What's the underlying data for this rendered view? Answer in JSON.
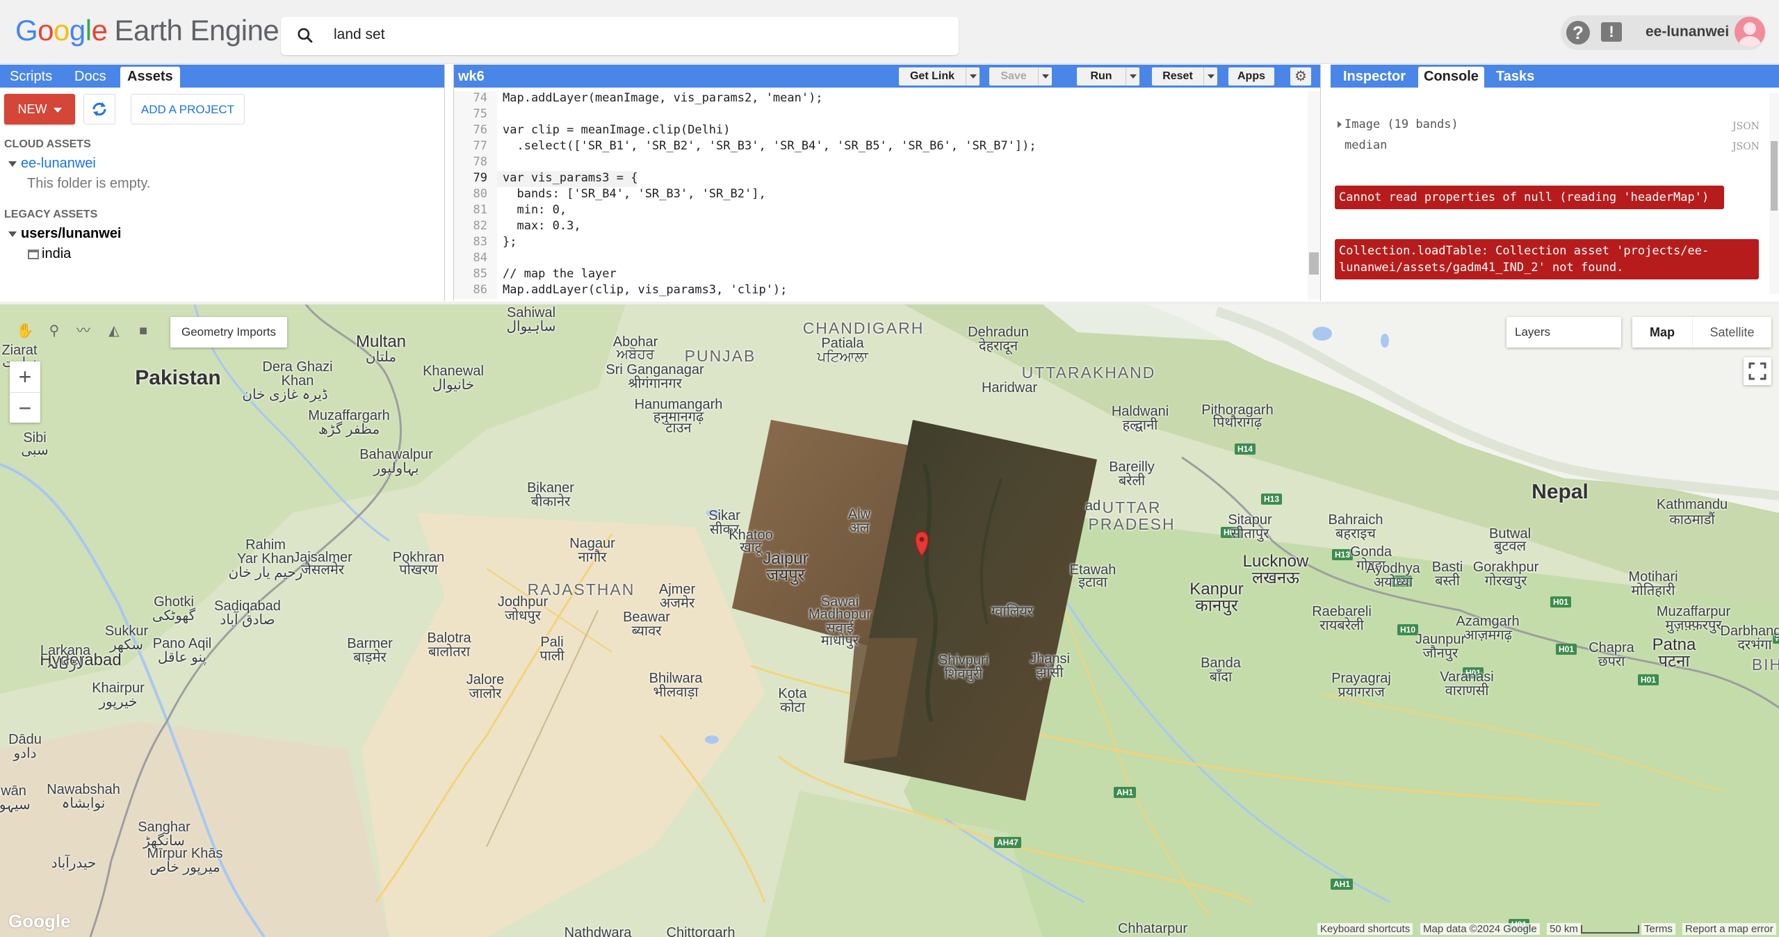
{
  "header": {
    "logo_google": [
      "G",
      "o",
      "o",
      "g",
      "l",
      "e"
    ],
    "logo_product": "Earth Engine",
    "search_value": "land set",
    "account_name": "ee-lunanwei",
    "help_glyph": "?",
    "feedback_glyph": "!"
  },
  "left_panel": {
    "tabs": [
      "Scripts",
      "Docs",
      "Assets"
    ],
    "active_tab": "Assets",
    "new_button": "NEW",
    "add_project_button": "ADD A PROJECT",
    "cloud_assets_label": "CLOUD ASSETS",
    "cloud_folder": "ee-lunanwei",
    "cloud_empty": "This folder is empty.",
    "legacy_assets_label": "LEGACY ASSETS",
    "legacy_folder": "users/lunanwei",
    "legacy_item": "india"
  },
  "code_panel": {
    "title": "wk6",
    "buttons": {
      "get_link": "Get Link",
      "save": "Save",
      "run": "Run",
      "reset": "Reset",
      "apps": "Apps"
    },
    "lines": [
      {
        "n": "74",
        "code": "Map.addLayer(meanImage, vis_params2, 'mean');"
      },
      {
        "n": "75",
        "code": ""
      },
      {
        "n": "76",
        "code": "var clip = meanImage.clip(Delhi)"
      },
      {
        "n": "77",
        "code": "  .select(['SR_B1', 'SR_B2', 'SR_B3', 'SR_B4', 'SR_B5', 'SR_B6', 'SR_B7']);"
      },
      {
        "n": "78",
        "code": ""
      },
      {
        "n": "79",
        "code": "var vis_params3 = {"
      },
      {
        "n": "80",
        "code": "  bands: ['SR_B4', 'SR_B3', 'SR_B2'],"
      },
      {
        "n": "81",
        "code": "  min: 0,"
      },
      {
        "n": "82",
        "code": "  max: 0.3,"
      },
      {
        "n": "83",
        "code": "};"
      },
      {
        "n": "84",
        "code": ""
      },
      {
        "n": "85",
        "code": "// map the layer"
      },
      {
        "n": "86",
        "code": "Map.addLayer(clip, vis_params3, 'clip');"
      }
    ]
  },
  "right_panel": {
    "tabs": [
      "Inspector",
      "Console",
      "Tasks"
    ],
    "active_tab": "Console",
    "console": {
      "image_label": "Image (19 bands)",
      "median_label": "median",
      "json_label": "JSON",
      "error1": "Cannot read properties of null (reading 'headerMap')",
      "error2_line1": "Collection.loadTable: Collection asset 'projects/ee-",
      "error2_line2": "lunanwei/assets/gadm41_IND_2' not found."
    }
  },
  "map": {
    "geometry_imports": "Geometry Imports",
    "layers": "Layers",
    "map_type": "Map",
    "satellite_type": "Satellite",
    "zoom_in": "+",
    "zoom_out": "−",
    "places": [
      {
        "id": "pakistan",
        "name": "Pakistan"
      },
      {
        "id": "nepal",
        "name": "Nepal"
      },
      {
        "id": "punjab",
        "name": "PUNJAB"
      },
      {
        "id": "uttarakhand",
        "name": "UTTARAKHAND"
      },
      {
        "id": "rajasthan",
        "name": "RAJASTHAN"
      },
      {
        "id": "uttar",
        "name": "UTTAR"
      },
      {
        "id": "pradesh",
        "name": "PRADESH"
      },
      {
        "id": "chandigarh",
        "name": "CHANDIGARH"
      },
      {
        "id": "multan",
        "name": "Multan"
      },
      {
        "id": "jaipur",
        "name": "Jaipur"
      },
      {
        "id": "jaipur_hi",
        "name": "जयपुर"
      },
      {
        "id": "lucknow",
        "name": "Lucknow"
      },
      {
        "id": "lucknow_hi",
        "name": "लखनऊ"
      },
      {
        "id": "kanpur",
        "name": "Kanpur"
      },
      {
        "id": "kanpur_hi",
        "name": "कानपुर"
      },
      {
        "id": "kathmandu",
        "name": "Kathmandu"
      },
      {
        "id": "kathmandu_ne",
        "name": "काठमाडौं"
      },
      {
        "id": "hyderabad",
        "name": "Hyderabad"
      },
      {
        "id": "patna",
        "name": "Patna"
      },
      {
        "id": "patna_hi",
        "name": "पटना"
      },
      {
        "id": "bikaner",
        "name": "Bikaner"
      },
      {
        "id": "bikaner_hi",
        "name": "बीकानेर"
      },
      {
        "id": "jodhpur",
        "name": "Jodhpur"
      },
      {
        "id": "jodhpur_hi",
        "name": "जोधपुर"
      },
      {
        "id": "ajmer",
        "name": "Ajmer"
      },
      {
        "id": "ajmer_hi",
        "name": "अजमेर"
      },
      {
        "id": "sikar",
        "name": "Sikar"
      },
      {
        "id": "sikar_hi",
        "name": "सीकर"
      },
      {
        "id": "nagaur",
        "name": "Nagaur"
      },
      {
        "id": "nagaur_hi",
        "name": "नागौर"
      },
      {
        "id": "dehradun",
        "name": "Dehradun"
      },
      {
        "id": "dehradun_hi",
        "name": "देहरादून"
      },
      {
        "id": "haldwani",
        "name": "Haldwani"
      },
      {
        "id": "haldwani_hi",
        "name": "हल्द्वानी"
      },
      {
        "id": "bareilly",
        "name": "Bareilly"
      },
      {
        "id": "bareilly_hi",
        "name": "बरेली"
      },
      {
        "id": "sitapur",
        "name": "Sitapur"
      },
      {
        "id": "sitapur_hi",
        "name": "सीतापुर"
      },
      {
        "id": "bahraich",
        "name": "Bahraich"
      },
      {
        "id": "bahraich_hi",
        "name": "बहराइच"
      },
      {
        "id": "gonda",
        "name": "Gonda"
      },
      {
        "id": "gonda_hi",
        "name": "गोण्डा"
      },
      {
        "id": "basti",
        "name": "Basti"
      },
      {
        "id": "basti_hi",
        "name": "बस्ती"
      },
      {
        "id": "gorakhpur",
        "name": "Gorakhpur"
      },
      {
        "id": "gorakhpur_hi",
        "name": "गोरखपुर"
      },
      {
        "id": "ayodhya",
        "name": "Ayodhya"
      },
      {
        "id": "ayodhya_hi",
        "name": "अयोध्या"
      },
      {
        "id": "raebareli",
        "name": "Raebareli"
      },
      {
        "id": "raebareli_hi",
        "name": "रायबरेली"
      },
      {
        "id": "azamgarh",
        "name": "Azamgarh"
      },
      {
        "id": "azamgarh_hi",
        "name": "आज़मगढ़"
      },
      {
        "id": "jaunpur",
        "name": "Jaunpur"
      },
      {
        "id": "jaunpur_hi",
        "name": "जौनपुर"
      },
      {
        "id": "varanasi",
        "name": "Varanasi"
      },
      {
        "id": "varanasi_hi",
        "name": "वाराणसी"
      },
      {
        "id": "prayagraj",
        "name": "Prayagraj"
      },
      {
        "id": "prayagraj_hi",
        "name": "प्रयागराज"
      },
      {
        "id": "chapra",
        "name": "Chapra"
      },
      {
        "id": "chapra_hi",
        "name": "छपरा"
      },
      {
        "id": "motihari",
        "name": "Motihari"
      },
      {
        "id": "motihari_hi",
        "name": "मोतिहारी"
      },
      {
        "id": "muzaffarpur",
        "name": "Muzaffarpur"
      },
      {
        "id": "muzaffarpur_hi",
        "name": "मुज़फ़्फ़रपुर"
      },
      {
        "id": "darbhanga",
        "name": "Darbhanga"
      },
      {
        "id": "darbhanga_hi",
        "name": "दरभंगा"
      },
      {
        "id": "butwal",
        "name": "Butwal"
      },
      {
        "id": "butwal_ne",
        "name": "बुटवल"
      },
      {
        "id": "banda",
        "name": "Banda"
      },
      {
        "id": "banda_hi",
        "name": "बाँदा"
      },
      {
        "id": "jhansi",
        "name": "Jhansi"
      },
      {
        "id": "jhansi_hi",
        "name": "झाँसी"
      },
      {
        "id": "shivpuri",
        "name": "Shivpuri"
      },
      {
        "id": "shivpuri_hi",
        "name": "शिवपुरी"
      },
      {
        "id": "gwalior_hi",
        "name": "ग्वालियर"
      },
      {
        "id": "etawah",
        "name": "Etawah"
      },
      {
        "id": "etawah_hi",
        "name": "इटावा"
      },
      {
        "id": "kota",
        "name": "Kota"
      },
      {
        "id": "kota_hi",
        "name": "कोटा"
      },
      {
        "id": "bhilwara",
        "name": "Bhilwara"
      },
      {
        "id": "bhilwara_hi",
        "name": "भीलवाड़ा"
      },
      {
        "id": "sawai",
        "name": "Sawai"
      },
      {
        "id": "sawai2",
        "name": "Madhopur"
      },
      {
        "id": "sawai_hi",
        "name": "सवाई"
      },
      {
        "id": "sawai_hi2",
        "name": "माधोपुर"
      },
      {
        "id": "beawar",
        "name": "Beawar"
      },
      {
        "id": "beawar_hi",
        "name": "ब्यावर"
      },
      {
        "id": "pali",
        "name": "Pali"
      },
      {
        "id": "pali_hi",
        "name": "पाली"
      },
      {
        "id": "balotra",
        "name": "Balotra"
      },
      {
        "id": "balotra_hi",
        "name": "बालोतरा"
      },
      {
        "id": "barmer",
        "name": "Barmer"
      },
      {
        "id": "barmer_hi",
        "name": "बाड़मेर"
      },
      {
        "id": "jalore",
        "name": "Jalore"
      },
      {
        "id": "jalore_hi",
        "name": "जालोर"
      },
      {
        "id": "jaisalmer",
        "name": "Jaisalmer"
      },
      {
        "id": "jaisalmer_hi",
        "name": "जैसलमेर"
      },
      {
        "id": "pokhran",
        "name": "Pokhran"
      },
      {
        "id": "pokhran_hi",
        "name": "पोखरण"
      },
      {
        "id": "khatoo",
        "name": "Khatoo"
      },
      {
        "id": "khatoo_hi",
        "name": "खाटू"
      },
      {
        "id": "hanumangarh",
        "name": "Hanumangarh"
      },
      {
        "id": "hanumangarh_hi",
        "name": "हनुमानगढ़"
      },
      {
        "id": "hanumangarh_hi2",
        "name": "टाउन"
      },
      {
        "id": "sriganganagar",
        "name": "Sri Ganganagar"
      },
      {
        "id": "sriganganagar_hi",
        "name": "श्रीगंगानगर"
      },
      {
        "id": "abohar",
        "name": "Abohar"
      },
      {
        "id": "abohar_pa",
        "name": "ਅਬੋਹਰ"
      },
      {
        "id": "patiala",
        "name": "Patiala"
      },
      {
        "id": "patiala_pa",
        "name": "ਪਟਿਆਲਾ"
      },
      {
        "id": "haridwar",
        "name": "Haridwar"
      },
      {
        "id": "pithoragarh",
        "name": "Pithoragarh"
      },
      {
        "id": "pithoragarh_hi",
        "name": "पिथौरागढ़"
      },
      {
        "id": "sahiwal",
        "name": "Sahiwal"
      },
      {
        "id": "sahiwal_ur",
        "name": "ساہیوال"
      },
      {
        "id": "deraghazi",
        "name": "Dera Ghazi"
      },
      {
        "id": "deraghazi2",
        "name": "Khan"
      },
      {
        "id": "deraghazi_ur",
        "name": "ڈیرہ غازی خان"
      },
      {
        "id": "multan_ur",
        "name": "ملتان"
      },
      {
        "id": "khanewal",
        "name": "Khanewal"
      },
      {
        "id": "khanewal_ur",
        "name": "خانیوال"
      },
      {
        "id": "muzaffargarh",
        "name": "Muzaffargarh"
      },
      {
        "id": "muzaffargarh_ur",
        "name": "مظفر گڑھ"
      },
      {
        "id": "bahawalpur",
        "name": "Bahawalpur"
      },
      {
        "id": "bahawalpur_ur",
        "name": "بہاولپور"
      },
      {
        "id": "rahim",
        "name": "Rahim"
      },
      {
        "id": "rahim2",
        "name": "Yar Khan"
      },
      {
        "id": "rahim_ur",
        "name": "رحیم یار خان"
      },
      {
        "id": "ghotki",
        "name": "Ghotki"
      },
      {
        "id": "ghotki_ur",
        "name": "گھوٹکی"
      },
      {
        "id": "sadiqabad",
        "name": "Sadiqabad"
      },
      {
        "id": "sadiqabad_ur",
        "name": "صادق آباد"
      },
      {
        "id": "sukkur",
        "name": "Sukkur"
      },
      {
        "id": "sukkur_ur",
        "name": "سکھر"
      },
      {
        "id": "panoaqil",
        "name": "Pano Aqil"
      },
      {
        "id": "panoaqil_ur",
        "name": "پنو عاقل"
      },
      {
        "id": "larkana",
        "name": "Larkana"
      },
      {
        "id": "larkana_ur",
        "name": "لاڑکانہ"
      },
      {
        "id": "khairpur",
        "name": "Khairpur"
      },
      {
        "id": "khairpur_ur",
        "name": "خیرپور"
      },
      {
        "id": "dadu",
        "name": "Dādu"
      },
      {
        "id": "dadu_ur",
        "name": "دادو"
      },
      {
        "id": "nawabshah",
        "name": "Nawabshah"
      },
      {
        "id": "nawabshah_ur",
        "name": "نوابشاہ"
      },
      {
        "id": "sanghar",
        "name": "Sanghar"
      },
      {
        "id": "sanghar_ur",
        "name": "سانگھڑ"
      },
      {
        "id": "hyderabad_ur",
        "name": "حیدرآباد"
      },
      {
        "id": "mirpur",
        "name": "Mīrpur Khās"
      },
      {
        "id": "mirpur_ur",
        "name": "میرپور خاص"
      },
      {
        "id": "sibi",
        "name": "Sibi"
      },
      {
        "id": "sibi_ur",
        "name": "سبی"
      },
      {
        "id": "zhob",
        "name": "Ziarat"
      },
      {
        "id": "zhob_ur",
        "name": "زیارت"
      },
      {
        "id": "hwan",
        "name": "hwān"
      },
      {
        "id": "hwan_ur",
        "name": "سیہون"
      },
      {
        "id": "nathdwara",
        "name": "Nathdwara"
      },
      {
        "id": "chittorgarh",
        "name": "Chittorgarh"
      },
      {
        "id": "chhatarpur",
        "name": "Chhatarpur"
      },
      {
        "id": "badaun",
        "name": "ad"
      },
      {
        "id": "alwar",
        "name": "Alw"
      },
      {
        "id": "alwar2",
        "name": "अल"
      },
      {
        "id": "bih",
        "name": "BIH"
      }
    ],
    "roads": [
      "H14",
      "H13",
      "H01",
      "H13",
      "H11",
      "H10",
      "H01",
      "H01",
      "H01",
      "H03",
      "H01",
      "AH1",
      "AH47",
      "AH1",
      "H01"
    ],
    "footer": {
      "keyboard": "Keyboard shortcuts",
      "mapdata": "Map data ©2024 Google",
      "scale": "50 km",
      "terms": "Terms",
      "report": "Report a map error"
    },
    "google_logo": "Google"
  }
}
